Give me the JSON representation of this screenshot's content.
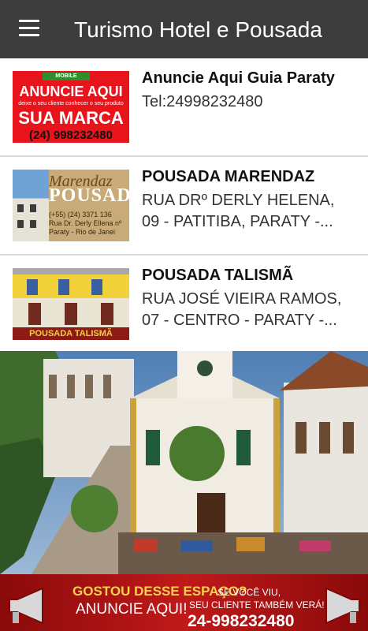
{
  "app": {
    "title": "Turismo Hotel e Pousada"
  },
  "listings": [
    {
      "name": "Anuncie Aqui Guia Paraty",
      "detail": "Tel:24998232480",
      "thumb": {
        "brand": "MOBILE",
        "headline": "ANUNCIE AQUI",
        "tagline": "deixe o seu cliente conhecer o seu produto",
        "big": "SUA MARCA",
        "phone": "(24) 998232480"
      }
    },
    {
      "name": "POUSADA MARENDAZ",
      "detail_line1": "RUA DRº DERLY HELENA,",
      "detail_line2": "09 - PATITIBA, PARATY -...",
      "thumb": {
        "script": "Marendaz",
        "big": "POUSADA",
        "phone": "(+55) (24) 3371 136",
        "street": "Rua Dr. Derly Ellena nº",
        "city": "Paraty - Rio de Janei"
      }
    },
    {
      "name": "POUSADA TALISMÃ",
      "detail_line1": "RUA JOSÉ VIEIRA RAMOS,",
      "detail_line2": "07 - CENTRO - PARATY -...",
      "thumb": {
        "banner": "POUSADA TALISMÃ"
      }
    }
  ],
  "banner": {
    "line1": "GOSTOU DESSE ESPAÇO?",
    "line2": "ANUNCIE AQUI!",
    "line3": "SE VOCÊ VIU,",
    "line4": "SEU CLIENTE TAMBÉM VERÁ!",
    "phone": "24-998232480"
  },
  "colors": {
    "toolbar": "#3c3c3c",
    "ad_red": "#e8141c",
    "banner_red": "#c0191a",
    "banner_yellow": "#f6d34a"
  }
}
